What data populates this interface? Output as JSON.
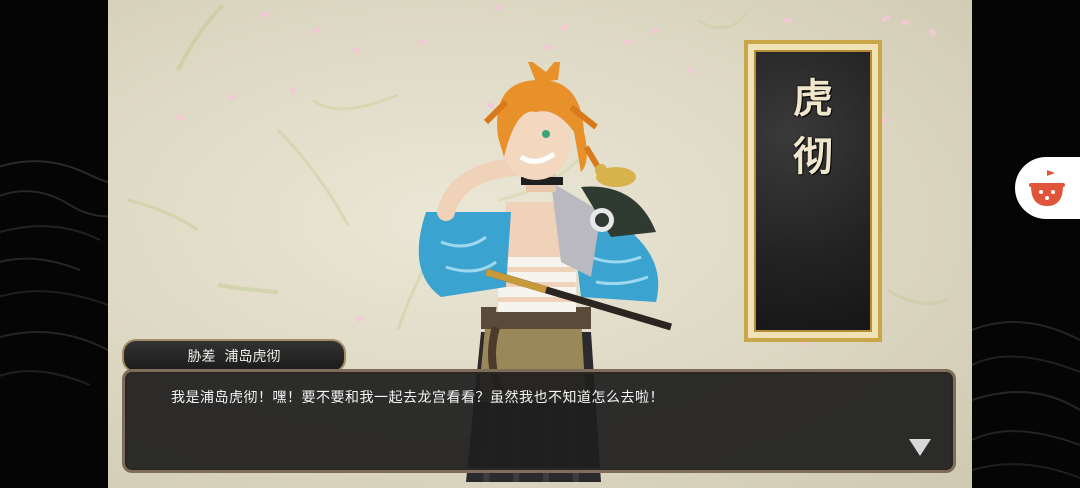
{
  "nameplate": {
    "chars": [
      "虎",
      "彻"
    ]
  },
  "speaker": {
    "name": "胁差  浦岛虎彻"
  },
  "dialog": {
    "text": "我是浦岛虎彻！嘿！要不要和我一起去龙宫看看？虽然我也不知道怎么去啦！"
  },
  "icons": {
    "advance": "triangle-down-icon",
    "floating": "tomato-assistant-icon"
  },
  "colors": {
    "accent_gold": "#c9a64a",
    "character_hair": "#e8902a",
    "character_kimono": "#3aa3d0",
    "floating_button": "#e0543a"
  }
}
